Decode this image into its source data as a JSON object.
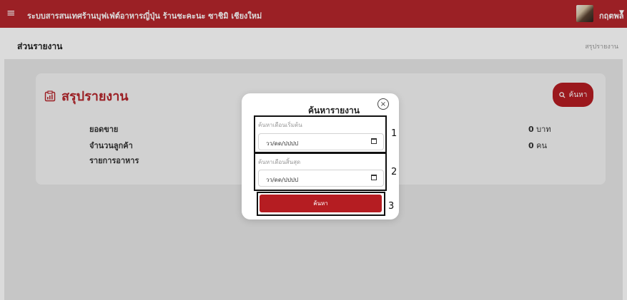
{
  "header": {
    "app_title": "ระบบสารสนเทศร้านบุฟเฟ่ต์อาหารญี่ปุ่น ร้านชะคะนะ ซาชิมิ เชียงใหม่",
    "user_name": "กฤตพล",
    "menu_icon": "hamburger-menu-icon",
    "caret_icon": "caret-down-icon"
  },
  "breadcrumb": {
    "section_title": "ส่วนรายงาน",
    "current": "สรุปรายงาน"
  },
  "summary_card": {
    "title": "สรุปรายงาน",
    "title_icon": "report-chart-icon",
    "search_button_label": "ค้นหา",
    "rows": [
      {
        "label": "ยอดขาย",
        "value": "0",
        "unit": "บาท"
      },
      {
        "label": "จำนวนลูกค้า",
        "value": "0",
        "unit": "คน"
      },
      {
        "label": "รายการอาหาร",
        "value": "",
        "unit": ""
      }
    ]
  },
  "modal": {
    "title": "ค้นหารายงาน",
    "start_label": "ค้นหาเดือนเริ่มต้น",
    "start_value": "วว/ดด/ปปปป",
    "end_label": "ค้นหาเดือนสิ้นสุด",
    "end_value": "วว/ดด/ปปปป",
    "submit_label": "ค้นหา"
  },
  "annotations": [
    "1",
    "2",
    "3"
  ],
  "colors": {
    "brand_red": "#b5262c",
    "button_red": "#b51d22",
    "content_gray": "#e7e7e7"
  }
}
